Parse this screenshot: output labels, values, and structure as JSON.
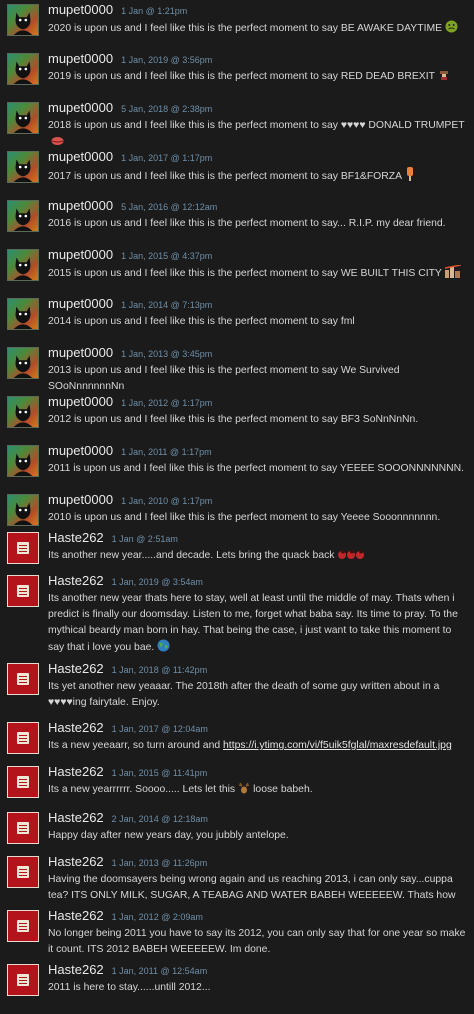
{
  "comments": [
    {
      "author": "mupet0000",
      "date": "1 Jan @ 1:21pm",
      "text": "2020 is upon us and I feel like this is the perfect moment to say BE AWAKE DAYTIME",
      "emoji": "sick-face-emoticon"
    },
    {
      "author": "mupet0000",
      "date": "1 Jan, 2019 @ 3:56pm",
      "text": "2019 is upon us and I feel like this is the perfect moment to say RED DEAD BREXIT",
      "emoji": "gunslinger-emoticon"
    },
    {
      "author": "mupet0000",
      "date": "5 Jan, 2018 @ 2:38pm",
      "text": "2018 is upon us and I feel like this is the perfect moment to say ♥♥♥♥ DONALD TRUMPET",
      "emoji": "lips-emoticon"
    },
    {
      "author": "mupet0000",
      "date": "1 Jan, 2017 @ 1:17pm",
      "text": "2017 is upon us and I feel like this is the perfect moment to say BF1&FORZA",
      "emoji": "ice-lolly-emoticon"
    },
    {
      "author": "mupet0000",
      "date": "5 Jan, 2016 @ 12:12am",
      "text": "2016 is upon us and I feel like this is the perfect moment to say... R.I.P. my dear friend.",
      "emoji": ""
    },
    {
      "author": "mupet0000",
      "date": "1 Jan, 2015 @ 4:37pm",
      "text": "2015 is upon us and I feel like this is the perfect moment to say WE BUILT THIS CITY",
      "emoji": "city-emoticon"
    },
    {
      "author": "mupet0000",
      "date": "1 Jan, 2014 @ 7:13pm",
      "text": "2014 is upon us and I feel like this is the perfect moment to say fml",
      "emoji": ""
    },
    {
      "author": "mupet0000",
      "date": "1 Jan, 2013 @ 3:45pm",
      "text": "2013 is upon us and I feel like this is the perfect moment to say We Survived SOoNnnnnnnNn",
      "emoji": ""
    },
    {
      "author": "mupet0000",
      "date": "1 Jan, 2012 @ 1:17pm",
      "text": "2012 is upon us and I feel like this is the perfect moment to say BF3 SoNnNnNn.",
      "emoji": ""
    },
    {
      "author": "mupet0000",
      "date": "1 Jan, 2011 @ 1:17pm",
      "text": "2011 is upon us and I feel like this is the perfect moment to say YEEEE SOOONNNNNNN.",
      "emoji": ""
    },
    {
      "author": "mupet0000",
      "date": "1 Jan, 2010 @ 1:17pm",
      "text": "2010 is upon us and I feel like this is the perfect moment to say Yeeee Sooonnnnnnn.",
      "emoji": ""
    },
    {
      "author": "Haste262",
      "date": "1 Jan @ 2:51am",
      "text": "Its another new year.....and decade. Lets bring the quack back",
      "emoji": "ducks-emoticon"
    },
    {
      "author": "Haste262",
      "date": "1 Jan, 2019 @ 3:54am",
      "text": "Its another new year thats here to stay, well at least until the middle of may. Thats when i predict is finally our doomsday. Listen to me, forget what baba say. Its time to pray. To the mythical beardy man born in hay. That being the case, i just want to take this moment to say that i love you bae.",
      "emoji": "globe-emoticon"
    },
    {
      "author": "Haste262",
      "date": "1 Jan, 2018 @ 11:42pm",
      "text": "Its yet another new yeaaar. The 2018th after the death of some guy written about in a ♥♥♥♥ing fairytale. Enjoy.",
      "emoji": ""
    },
    {
      "author": "Haste262",
      "date": "1 Jan, 2017 @ 12:04am",
      "text": "Its a new yeeaarr, so turn around and",
      "link": "https://i.ytimg.com/vi/f5uik5fglal/maxresdefault.jpg",
      "emoji": ""
    },
    {
      "author": "Haste262",
      "date": "1 Jan, 2015 @ 11:41pm",
      "text": "Its a new yearrrrrr. Soooo..... Lets let this",
      "text2": "loose babeh.",
      "emoji": "deer-emoticon"
    },
    {
      "author": "Haste262",
      "date": "2 Jan, 2014 @ 12:18am",
      "text": "Happy day after new years day, you jubbly antelope.",
      "emoji": ""
    },
    {
      "author": "Haste262",
      "date": "1 Jan, 2013 @ 11:26pm",
      "text": "Having the doomsayers being wrong again and us reaching 2013, i can only say...cuppa tea? ITS ONLY MILK, SUGAR, A TEABAG AND WATER BABEH WEEEEEW. Thats how its done.",
      "emoji": ""
    },
    {
      "author": "Haste262",
      "date": "1 Jan, 2012 @ 2:09am",
      "text": "No longer being 2011 you have to say its 2012, you can only say that for one year so make it count. ITS 2012 BABEH WEEEEEW. Im done.",
      "emoji": ""
    },
    {
      "author": "Haste262",
      "date": "1 Jan, 2011 @ 12:54am",
      "text": "2011 is here to stay......untill 2012...",
      "emoji": ""
    }
  ],
  "colors": {
    "background": "#1b1b1b",
    "date": "#6f8fa8",
    "text": "#d6d6d6",
    "author": "#e9e9e9"
  }
}
